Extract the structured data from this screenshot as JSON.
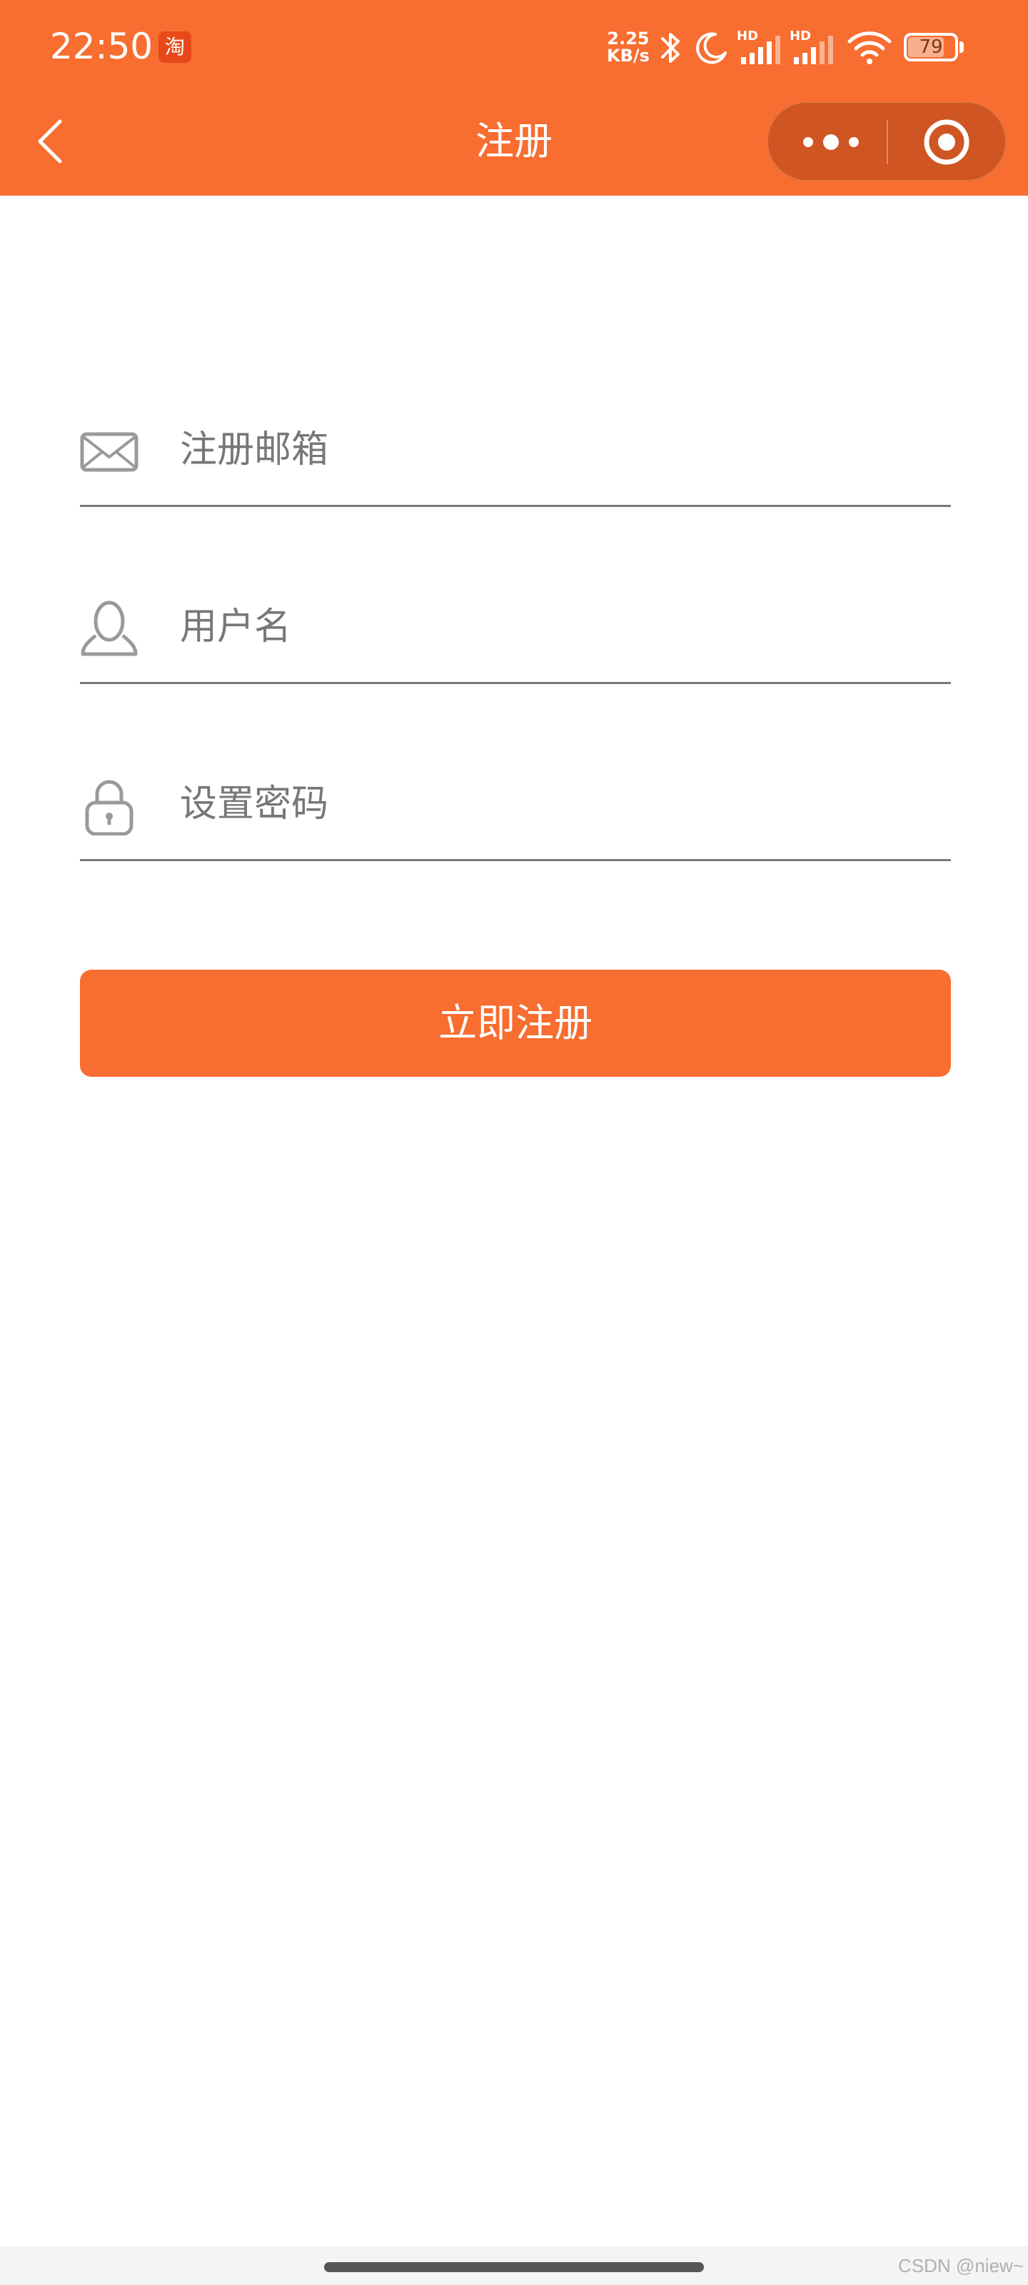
{
  "status_bar": {
    "time": "22:50",
    "app_badge": "淘",
    "net_speed_value": "2.25",
    "net_speed_unit": "KB/s",
    "signal_1_label": "HD",
    "signal_2_label": "HD",
    "battery": "79"
  },
  "nav": {
    "title": "注册"
  },
  "form": {
    "email_placeholder": "注册邮箱",
    "username_placeholder": "用户名",
    "password_placeholder": "设置密码",
    "submit_label": "立即注册"
  },
  "footer": {
    "watermark": "CSDN @niew~"
  },
  "colors": {
    "brand": "#f86d30",
    "capsule": "#cf5522",
    "icon_gray": "#9a9a9a"
  }
}
